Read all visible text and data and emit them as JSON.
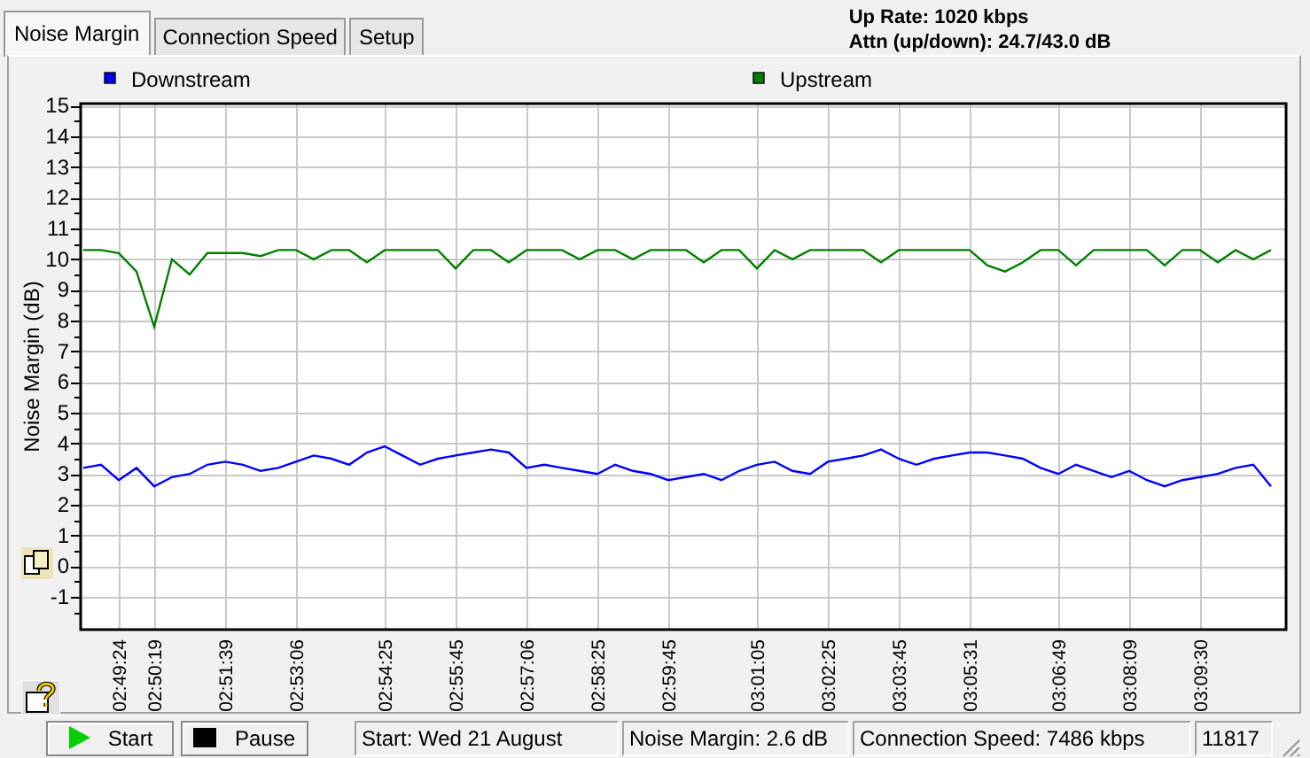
{
  "tabs": [
    {
      "label": "Noise Margin",
      "selected": true
    },
    {
      "label": "Connection Speed",
      "selected": false
    },
    {
      "label": "Setup",
      "selected": false
    }
  ],
  "info": [
    "Up Rate: 1020 kbps",
    "Attn (up/down): 24.7/43.0 dB"
  ],
  "chart": {
    "chart_data": {
      "type": "line",
      "ylabel": "Noise Margin (dB)",
      "categories": [
        null,
        null,
        "02:49:24",
        null,
        "02:50:19",
        null,
        null,
        null,
        "02:51:39",
        null,
        null,
        null,
        "02:53:06",
        null,
        null,
        null,
        null,
        "02:54:25",
        null,
        null,
        null,
        "02:55:45",
        null,
        null,
        null,
        "02:57:06",
        null,
        null,
        null,
        "02:58:25",
        null,
        null,
        null,
        "02:59:45",
        null,
        null,
        null,
        null,
        "03:01:05",
        null,
        null,
        null,
        "03:02:25",
        null,
        null,
        null,
        "03:03:45",
        null,
        null,
        null,
        "03:05:31",
        null,
        null,
        null,
        null,
        "03:06:49",
        null,
        null,
        null,
        "03:08:09",
        null,
        null,
        null,
        "03:09:30",
        null,
        null,
        null,
        null
      ],
      "series": [
        {
          "name": "Downstream",
          "color": "#0000ff",
          "values": [
            3.2,
            3.3,
            2.8,
            3.2,
            2.6,
            2.9,
            3.0,
            3.3,
            3.4,
            3.3,
            3.1,
            3.2,
            3.4,
            3.6,
            3.5,
            3.3,
            3.7,
            3.9,
            3.6,
            3.3,
            3.5,
            3.6,
            3.7,
            3.8,
            3.7,
            3.2,
            3.3,
            3.2,
            3.1,
            3.0,
            3.3,
            3.1,
            3.0,
            2.8,
            2.9,
            3.0,
            2.8,
            3.1,
            3.3,
            3.4,
            3.1,
            3.0,
            3.4,
            3.5,
            3.6,
            3.8,
            3.5,
            3.3,
            3.5,
            3.6,
            3.7,
            3.7,
            3.6,
            3.5,
            3.2,
            3.0,
            3.3,
            3.1,
            2.9,
            3.1,
            2.8,
            2.6,
            2.8,
            2.9,
            3.0,
            3.2,
            3.3,
            2.6
          ]
        },
        {
          "name": "Upstream",
          "color": "#008000",
          "values": [
            10.3,
            10.3,
            10.2,
            9.6,
            7.8,
            10.0,
            9.5,
            10.2,
            10.2,
            10.2,
            10.1,
            10.3,
            10.3,
            10.0,
            10.3,
            10.3,
            9.9,
            10.3,
            10.3,
            10.3,
            10.3,
            9.7,
            10.3,
            10.3,
            9.9,
            10.3,
            10.3,
            10.3,
            10.0,
            10.3,
            10.3,
            10.0,
            10.3,
            10.3,
            10.3,
            9.9,
            10.3,
            10.3,
            9.7,
            10.3,
            10.0,
            10.3,
            10.3,
            10.3,
            10.3,
            9.9,
            10.3,
            10.3,
            10.3,
            10.3,
            10.3,
            9.8,
            9.6,
            9.9,
            10.3,
            10.3,
            9.8,
            10.3,
            10.3,
            10.3,
            10.3,
            9.8,
            10.3,
            10.3,
            9.9,
            10.3,
            10.0,
            10.3
          ]
        }
      ],
      "ylim": [
        -2.1,
        15.1
      ],
      "grid": true,
      "legend": true,
      "yticks": [
        -1,
        0,
        1,
        2,
        3,
        4,
        5,
        6,
        7,
        8,
        9,
        10,
        11,
        12,
        13,
        14,
        15
      ]
    }
  },
  "controls": [
    {
      "label": "Start",
      "kind": "play"
    },
    {
      "label": "Pause",
      "kind": "pause"
    }
  ],
  "status_bar": [
    "Start: Wed 21 August",
    "Noise Margin: 2.6 dB",
    "Connection Speed: 7486 kbps",
    "11817"
  ]
}
